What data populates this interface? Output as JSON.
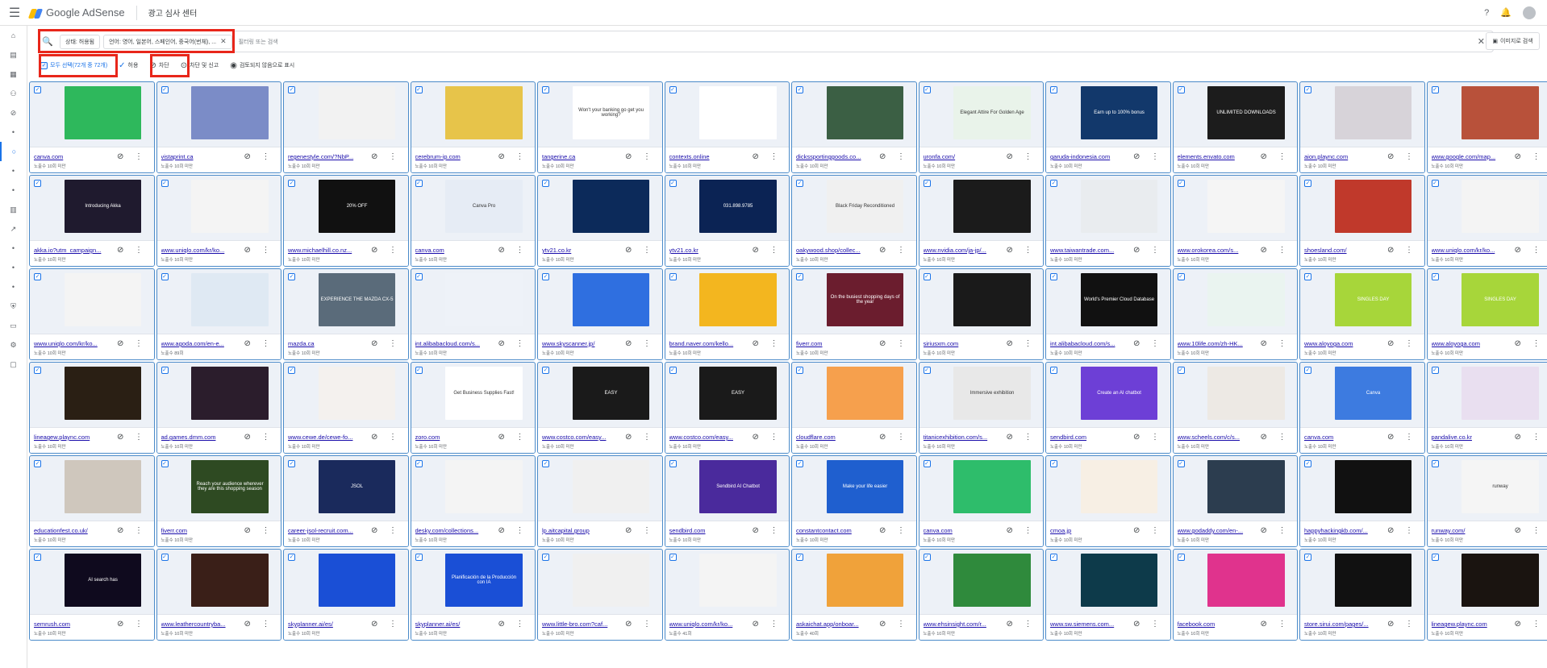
{
  "header": {
    "menu_icon": "hamburger-icon",
    "app_name": "Google AdSense",
    "page_title": "광고 심사 센터",
    "help_icon": "help-icon",
    "bell_icon": "bell-icon"
  },
  "sidebar": {
    "items": [
      "home-icon",
      "ads-icon",
      "sites-icon",
      "users-icon",
      "block-icon",
      "dot-icon",
      "circle-icon",
      "dot-icon",
      "dot-icon",
      "report-icon",
      "trend-icon",
      "dot-icon",
      "dot-icon",
      "dot-icon",
      "shield-icon",
      "payment-icon",
      "settings-icon",
      "feedback-icon"
    ]
  },
  "filter": {
    "chip_status": "상태: 허용됨",
    "chip_language": "언어: 영어, 일본어, 스페인어, 중국어(번체), ...",
    "placeholder": "필터링 또는 검색",
    "image_search": "이미지로 검색"
  },
  "actions": {
    "select_all": "모두 선택(72개 중 72개)",
    "allow": "허용",
    "block": "차단",
    "block_report": "차단 및 신고",
    "mark_unreviewed": "검토되지 않음으로 표시"
  },
  "cards": [
    {
      "domain": "canva.com",
      "impr": "노출수 10회 미만",
      "bg": "#2eb85c",
      "text": ""
    },
    {
      "domain": "vistaprint.ca",
      "impr": "노출수 10회 미만",
      "bg": "#7b8cc7",
      "text": ""
    },
    {
      "domain": "regenestyle.com/?NbP...",
      "impr": "노출수 10회 미만",
      "bg": "#f2f2f2",
      "text": ""
    },
    {
      "domain": "cerebrum-ip.com",
      "impr": "노출수 10회 미만",
      "bg": "#e7c44a",
      "text": ""
    },
    {
      "domain": "tangerine.ca",
      "impr": "노출수 10회 미만",
      "bg": "#ffffff",
      "text": "Won't your banking go get you working?"
    },
    {
      "domain": "contexts.online",
      "impr": "노출수 10회 미만",
      "bg": "#ffffff",
      "text": ""
    },
    {
      "domain": "dickssportinggoods.co...",
      "impr": "노출수 10회 미만",
      "bg": "#3b5f44",
      "text": ""
    },
    {
      "domain": "uronfa.com/",
      "impr": "노출수 10회 미만",
      "bg": "#e9f3ea",
      "text": "Elegant Attire For Golden Age"
    },
    {
      "domain": "garuda-indonesia.com",
      "impr": "노출수 10회 미만",
      "bg": "#12386b",
      "text": "Earn up to 100% bonus"
    },
    {
      "domain": "elements.envato.com",
      "impr": "노출수 10회 미만",
      "bg": "#1c1c1c",
      "text": "UNLIMITED DOWNLOADS"
    },
    {
      "domain": "aion.plaync.com",
      "impr": "노출수 10회 미만",
      "bg": "#d7d3d9",
      "text": ""
    },
    {
      "domain": "www.google.com/map...",
      "impr": "노출수 10회 미만",
      "bg": "#b8513a",
      "text": ""
    },
    {
      "domain": "akka.io?utm_campaign...",
      "impr": "노출수 10회 미만",
      "bg": "#1f1a2e",
      "text": "Introducing Akka"
    },
    {
      "domain": "www.uniqlo.com/kr/ko...",
      "impr": "노출수 10회 미만",
      "bg": "#f4f4f4",
      "text": ""
    },
    {
      "domain": "www.michaelhill.co.nz...",
      "impr": "노출수 10회 미만",
      "bg": "#111111",
      "text": "20% OFF"
    },
    {
      "domain": "canva.com",
      "impr": "노출수 10회 미만",
      "bg": "#e6ecf5",
      "text": "Canva Pro"
    },
    {
      "domain": "ytv21.co.kr",
      "impr": "노출수 10회 미만",
      "bg": "#0c2a5a",
      "text": ""
    },
    {
      "domain": "ytv21.co.kr",
      "impr": "노출수 10회 미만",
      "bg": "#0b2354",
      "text": "031.898.9785"
    },
    {
      "domain": "oakywood.shop/collec...",
      "impr": "노출수 10회 미만",
      "bg": "#f0f0f0",
      "text": "Black Friday Reconditioned"
    },
    {
      "domain": "www.nvidia.com/ja-jp/...",
      "impr": "노출수 10회 미만",
      "bg": "#1b1b1b",
      "text": ""
    },
    {
      "domain": "www.taiwantrade.com...",
      "impr": "노출수 10회 미만",
      "bg": "#e9ecef",
      "text": ""
    },
    {
      "domain": "www.orokorea.com/s...",
      "impr": "노출수 10회 미만",
      "bg": "#f5f5f5",
      "text": ""
    },
    {
      "domain": "shoesland.com/",
      "impr": "노출수 10회 미만",
      "bg": "#c0392b",
      "text": ""
    },
    {
      "domain": "www.uniqlo.com/kr/ko...",
      "impr": "노출수 10회 미만",
      "bg": "#f4f4f4",
      "text": ""
    },
    {
      "domain": "www.uniqlo.com/kr/ko...",
      "impr": "노출수 10회 미만",
      "bg": "#f4f4f4",
      "text": ""
    },
    {
      "domain": "www.agoda.com/en-e...",
      "impr": "노출수 89회",
      "bg": "#dfe9f3",
      "text": ""
    },
    {
      "domain": "mazda.ca",
      "impr": "노출수 10회 미만",
      "bg": "#5a6b7a",
      "text": "EXPERIENCE THE MAZDA CX-5"
    },
    {
      "domain": "int.alibabacloud.com/s...",
      "impr": "노출수 10회 미만",
      "bg": "#eef2f8",
      "text": ""
    },
    {
      "domain": "www.skyscanner.jp/",
      "impr": "노출수 10회 미만",
      "bg": "#2f6fe0",
      "text": ""
    },
    {
      "domain": "brand.naver.com/kello...",
      "impr": "노출수 10회 미만",
      "bg": "#f3b61f",
      "text": ""
    },
    {
      "domain": "fiverr.com",
      "impr": "노출수 10회 미만",
      "bg": "#6b1d2e",
      "text": "On the busiest shopping days of the year"
    },
    {
      "domain": "siriusxm.com",
      "impr": "노출수 10회 미만",
      "bg": "#1a1a1a",
      "text": ""
    },
    {
      "domain": "int.alibabacloud.com/s...",
      "impr": "노출수 10회 미만",
      "bg": "#111111",
      "text": "World's Premier Cloud Database"
    },
    {
      "domain": "www.10life.com/zh-HK...",
      "impr": "노출수 10회 미만",
      "bg": "#eaf4f0",
      "text": ""
    },
    {
      "domain": "www.aloyoga.com",
      "impr": "노출수 10회 미만",
      "bg": "#a7d63a",
      "text": "SINGLES DAY"
    },
    {
      "domain": "www.aloyoga.com",
      "impr": "노출수 10회 미만",
      "bg": "#a7d63a",
      "text": "SINGLES DAY"
    },
    {
      "domain": "lineagew.plaync.com",
      "impr": "노출수 10회 미만",
      "bg": "#2a1f14",
      "text": ""
    },
    {
      "domain": "ad.games.dmm.com",
      "impr": "노출수 10회 미만",
      "bg": "#2b1d2c",
      "text": ""
    },
    {
      "domain": "www.cewe.de/cewe-fo...",
      "impr": "노출수 10회 미만",
      "bg": "#f4f1ee",
      "text": ""
    },
    {
      "domain": "zoro.com",
      "impr": "노출수 10회 미만",
      "bg": "#ffffff",
      "text": "Get Business Supplies Fast!"
    },
    {
      "domain": "www.costco.com/easy...",
      "impr": "노출수 10회 미만",
      "bg": "#1a1a1a",
      "text": "EASY"
    },
    {
      "domain": "www.costco.com/easy...",
      "impr": "노출수 10회 미만",
      "bg": "#1a1a1a",
      "text": "EASY"
    },
    {
      "domain": "cloudflare.com",
      "impr": "노출수 10회 미만",
      "bg": "#f6a04d",
      "text": ""
    },
    {
      "domain": "titanicexhibition.com/s...",
      "impr": "노출수 10회 미만",
      "bg": "#e8e8e8",
      "text": "Immersive exhibition"
    },
    {
      "domain": "sendbird.com",
      "impr": "노출수 10회 미만",
      "bg": "#6d3fd6",
      "text": "Create an AI chatbot"
    },
    {
      "domain": "www.scheels.com/c/s...",
      "impr": "노출수 10회 미만",
      "bg": "#ede9e4",
      "text": ""
    },
    {
      "domain": "canva.com",
      "impr": "노출수 10회 미만",
      "bg": "#3d7be0",
      "text": "Canva"
    },
    {
      "domain": "pandalive.co.kr",
      "impr": "노출수 10회 미만",
      "bg": "#e9dff0",
      "text": ""
    },
    {
      "domain": "educationfest.co.uk/",
      "impr": "노출수 10회 미만",
      "bg": "#cfc7bd",
      "text": ""
    },
    {
      "domain": "fiverr.com",
      "impr": "노출수 10회 미만",
      "bg": "#2e4a22",
      "text": "Reach your audience wherever they are this shopping season"
    },
    {
      "domain": "career-jsol-recruit.com...",
      "impr": "노출수 10회 미만",
      "bg": "#1a2a5c",
      "text": "JSOL"
    },
    {
      "domain": "desky.com/collections...",
      "impr": "노출수 10회 미만",
      "bg": "#f4f4f4",
      "text": ""
    },
    {
      "domain": "lp.aitcapital.group",
      "impr": "노출수 10회 미만",
      "bg": "#f0f0f0",
      "text": ""
    },
    {
      "domain": "sendbird.com",
      "impr": "노출수 10회 미만",
      "bg": "#4a2a9c",
      "text": "Sendbird AI Chatbot"
    },
    {
      "domain": "constantcontact.com",
      "impr": "노출수 10회 미만",
      "bg": "#1f5fcf",
      "text": "Make your life easier"
    },
    {
      "domain": "canva.com",
      "impr": "노출수 10회 미만",
      "bg": "#2ebd6b",
      "text": ""
    },
    {
      "domain": "cmoa.jp",
      "impr": "노출수 10회 미만",
      "bg": "#f7efe4",
      "text": ""
    },
    {
      "domain": "www.godaddy.com/en-...",
      "impr": "노출수 10회 미만",
      "bg": "#2c3d4f",
      "text": ""
    },
    {
      "domain": "happyhackingkb.com/...",
      "impr": "노출수 10회 미만",
      "bg": "#111111",
      "text": ""
    },
    {
      "domain": "runway.com/",
      "impr": "노출수 10회 미만",
      "bg": "#f5f5f5",
      "text": "runway"
    },
    {
      "domain": "semrush.com",
      "impr": "노출수 10회 미만",
      "bg": "#0f0a1e",
      "text": "AI search has"
    },
    {
      "domain": "www.leathercountryba...",
      "impr": "노출수 10회 미만",
      "bg": "#3a1f18",
      "text": ""
    },
    {
      "domain": "skyplanner.ai/es/",
      "impr": "노출수 10회 미만",
      "bg": "#1a4fd6",
      "text": ""
    },
    {
      "domain": "skyplanner.ai/es/",
      "impr": "노출수 10회 미만",
      "bg": "#1a4fd6",
      "text": "Planificación de la Producción con IA"
    },
    {
      "domain": "www.little-bro.com?caf...",
      "impr": "노출수 10회 미만",
      "bg": "#f0f0f0",
      "text": ""
    },
    {
      "domain": "www.uniqlo.com/kr/ko...",
      "impr": "노출수 41회",
      "bg": "#f4f4f4",
      "text": ""
    },
    {
      "domain": "askaichat.app/onboar...",
      "impr": "노출수 40회",
      "bg": "#f0a23a",
      "text": ""
    },
    {
      "domain": "www.ehsinsight.com/r...",
      "impr": "노출수 10회 미만",
      "bg": "#2f8a3c",
      "text": ""
    },
    {
      "domain": "www.sw.siemens.com...",
      "impr": "노출수 10회 미만",
      "bg": "#0d3a4a",
      "text": ""
    },
    {
      "domain": "facebook.com",
      "impr": "노출수 10회 미만",
      "bg": "#e0338d",
      "text": ""
    },
    {
      "domain": "store.sirui.com/pages/...",
      "impr": "노출수 10회 미만",
      "bg": "#111111",
      "text": ""
    },
    {
      "domain": "lineagew.plaync.com",
      "impr": "노출수 10회 미만",
      "bg": "#1a1410",
      "text": ""
    }
  ]
}
